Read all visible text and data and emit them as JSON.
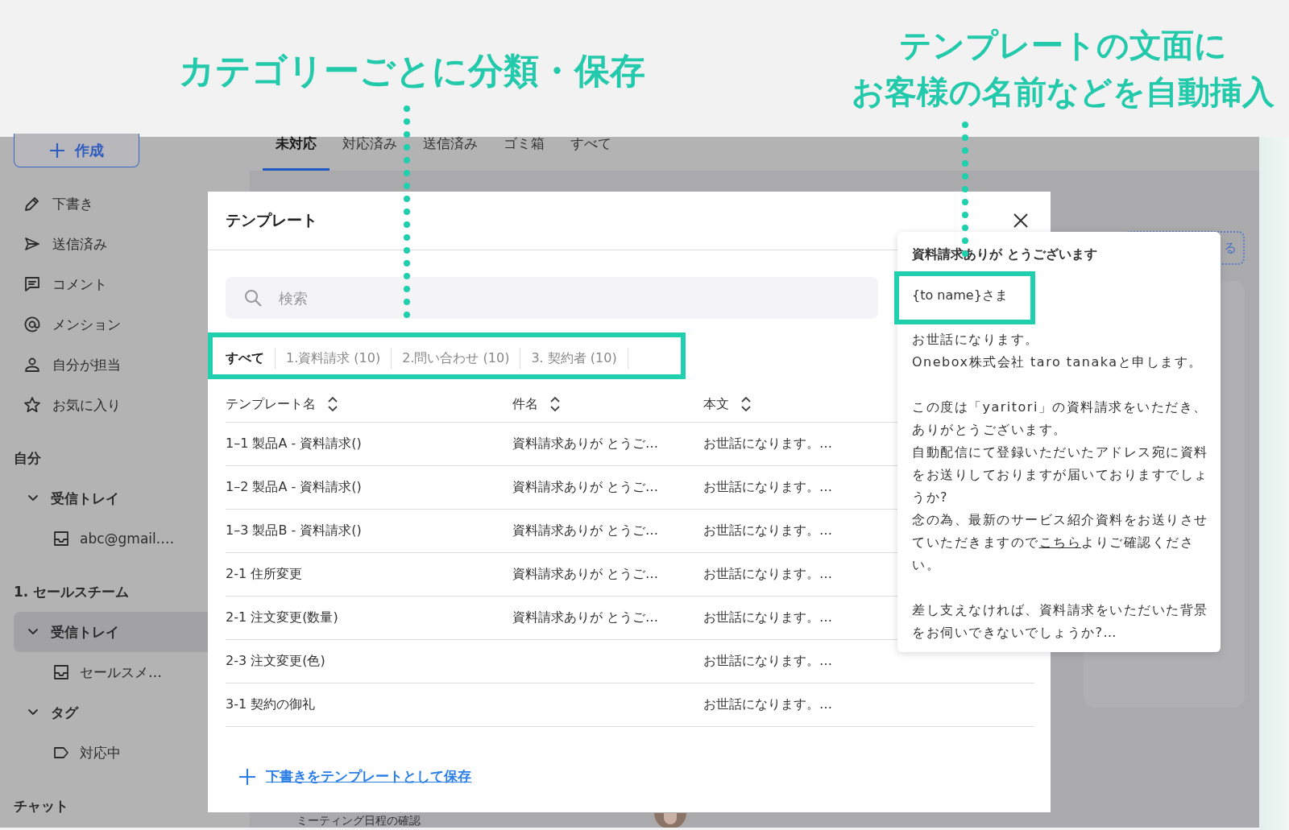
{
  "headlines": [
    {
      "lines": [
        "カテゴリーごとに分類・保存"
      ]
    },
    {
      "lines": [
        "テンプレートの文面に",
        "お客様の名前などを自動挿入"
      ]
    }
  ],
  "sidebar": {
    "compose_button": "作成",
    "nav": [
      {
        "label": "下書き"
      },
      {
        "label": "送信済み"
      },
      {
        "label": "コメント"
      },
      {
        "label": "メンション"
      },
      {
        "label": "自分が担当"
      },
      {
        "label": "お気に入り"
      }
    ],
    "tree": [
      {
        "label": "自分",
        "children": [
          {
            "label": "受信トレイ",
            "expanded": true,
            "selected": false,
            "children": [
              {
                "label": "abc@gmail.…",
                "kind": "inbox",
                "selected": false
              }
            ]
          }
        ]
      },
      {
        "label": "1. セールスチーム",
        "children": [
          {
            "label": "受信トレイ",
            "expanded": true,
            "selected": true,
            "children": [
              {
                "label": "セールスメ…",
                "kind": "inbox",
                "selected": false
              }
            ]
          },
          {
            "label": "タグ",
            "expanded": true,
            "selected": false,
            "children": [
              {
                "label": "対応中",
                "kind": "tag",
                "selected": false
              }
            ]
          }
        ]
      },
      {
        "label": "チャット"
      }
    ]
  },
  "main": {
    "tabs": [
      {
        "label": "未対応",
        "selected": true
      },
      {
        "label": "対応済み",
        "selected": false
      },
      {
        "label": "送信済み",
        "selected": false
      },
      {
        "label": "ゴミ箱",
        "selected": false
      },
      {
        "label": "すべて",
        "selected": false
      }
    ],
    "message_subject": "ミーティング日程の確認",
    "action_button": "る"
  },
  "modal": {
    "title": "テンプレート",
    "search": {
      "placeholder": "検索"
    },
    "categories": [
      {
        "label": "すべて",
        "selected": true
      },
      {
        "label": "1.資料請求 (10)",
        "selected": false
      },
      {
        "label": "2.問い合わせ (10)",
        "selected": false
      },
      {
        "label": "3. 契約者 (10)",
        "selected": false
      }
    ],
    "columns": [
      "テンプレート名",
      "件名",
      "本文"
    ],
    "rows": [
      {
        "template_name": "1–1 製品A - 資料請求()",
        "subject": "資料請求ありが とうご…",
        "body": "お世話になります。…"
      },
      {
        "template_name": "1–2 製品A - 資料請求()",
        "subject": "資料請求ありが とうご…",
        "body": "お世話になります。…"
      },
      {
        "template_name": "1–3 製品B - 資料請求()",
        "subject": "資料請求ありが とうご…",
        "body": "お世話になります。…"
      },
      {
        "template_name": "2-1 住所変更",
        "subject": "資料請求ありが とうご…",
        "body": "お世話になります。…"
      },
      {
        "template_name": "2-1 注文変更(数量)",
        "subject": "資料請求ありが とうご…",
        "body": "お世話になります。…"
      },
      {
        "template_name": "2-3 注文変更(色)",
        "body": "お世話になります。…"
      },
      {
        "template_name": "3-1 契約の御礼",
        "body": "お世話になります。…"
      }
    ],
    "save_link": "下書きをテンプレートとして保存"
  },
  "preview": {
    "subject": "資料請求ありが とうございます",
    "greeting": "{to name}さま",
    "paragraphs": [
      [
        [
          {
            "kind": "text",
            "text": "お世話になります。"
          }
        ],
        [
          {
            "kind": "text",
            "text": "Onebox株式会社 taro tanakaと申します。"
          }
        ]
      ],
      [
        [
          {
            "kind": "text",
            "text": "この度は「yaritori」の資料請求をいただき、ありがとうございます。"
          }
        ],
        [
          {
            "kind": "text",
            "text": "自動配信にて登録いただいたアドレス宛に資料をお送りしておりますが届いておりますでしょうか?"
          }
        ],
        [
          {
            "kind": "text",
            "text": "念の為、最新のサービス紹介資料をお送りさせていただきますので"
          },
          {
            "kind": "link",
            "text": "こちら"
          },
          {
            "kind": "text",
            "text": "よりご確認ください。"
          }
        ]
      ],
      [
        [
          {
            "kind": "text",
            "text": "差し支えなければ、資料請求をいただいた背景をお伺いできないでしょうか?…"
          }
        ]
      ]
    ]
  }
}
